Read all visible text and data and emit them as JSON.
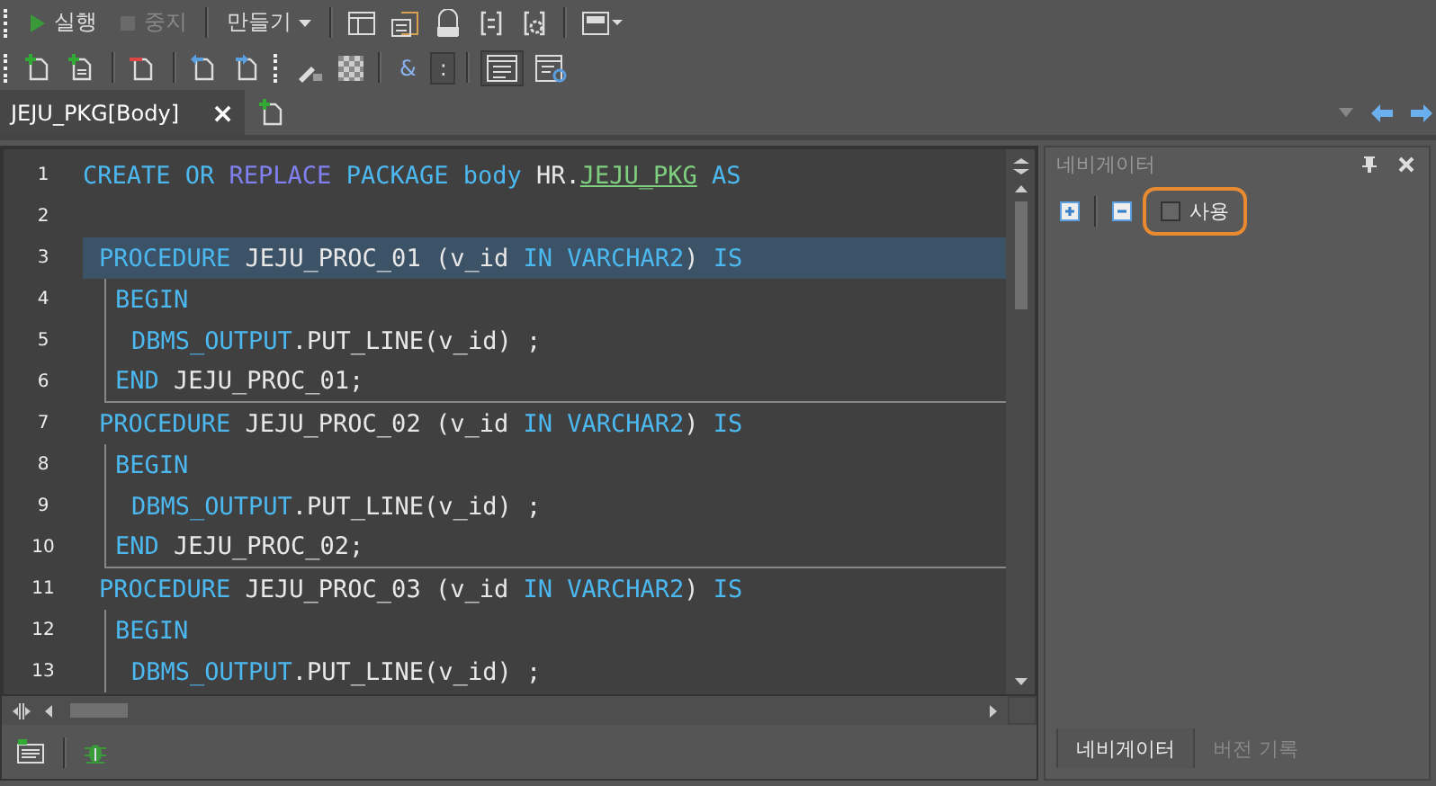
{
  "toolbar": {
    "run_label": "실행",
    "stop_label": "중지",
    "stop_disabled": true,
    "create_label": "만들기"
  },
  "toolbar2": {
    "amp_label": "&",
    "colon_label": ":"
  },
  "tabs": [
    {
      "label": "JEJU_PKG[Body]",
      "selected": true,
      "close": "×"
    }
  ],
  "editor": {
    "lines": [
      {
        "number": "1",
        "kind": "header",
        "selected": false,
        "tokens": [
          {
            "text": "CREATE OR ",
            "kind": "kw"
          },
          {
            "text": "REPLACE",
            "kind": "kw2"
          },
          {
            "text": " PACKAGE body ",
            "kind": "kw"
          },
          {
            "text": "HR.",
            "kind": "plain"
          },
          {
            "text": "JEJU_PKG",
            "kind": "link"
          },
          {
            "text": " AS",
            "kind": "kw"
          }
        ]
      },
      {
        "number": "2",
        "kind": "blank",
        "selected": false
      },
      {
        "number": "3",
        "kind": "proc",
        "selected": true,
        "tokens": [
          {
            "text": "PROCEDURE",
            "kind": "kw"
          },
          {
            "text": " JEJU_PROC_01 (v_id ",
            "kind": "plain"
          },
          {
            "text": "IN VARCHAR2",
            "kind": "kw"
          },
          {
            "text": ") ",
            "kind": "plain"
          },
          {
            "text": "IS",
            "kind": "kw"
          }
        ]
      },
      {
        "number": "4",
        "kind": "begin",
        "selected": false,
        "tokens": [
          {
            "text": "BEGIN",
            "kind": "kw"
          }
        ]
      },
      {
        "number": "5",
        "kind": "body",
        "selected": false,
        "tokens": [
          {
            "text": "DBMS_OUTPUT",
            "kind": "kw"
          },
          {
            "text": ".PUT_LINE(v_id) ;",
            "kind": "plain"
          }
        ]
      },
      {
        "number": "6",
        "kind": "end",
        "selected": false,
        "tokens": [
          {
            "text": "END",
            "kind": "kw"
          },
          {
            "text": " JEJU_PROC_01;",
            "kind": "plain"
          }
        ]
      },
      {
        "number": "7",
        "kind": "proc",
        "selected": false,
        "tokens": [
          {
            "text": "PROCEDURE",
            "kind": "kw"
          },
          {
            "text": " JEJU_PROC_02 (v_id ",
            "kind": "plain"
          },
          {
            "text": "IN VARCHAR2",
            "kind": "kw"
          },
          {
            "text": ") ",
            "kind": "plain"
          },
          {
            "text": "IS",
            "kind": "kw"
          }
        ]
      },
      {
        "number": "8",
        "kind": "begin",
        "selected": false,
        "tokens": [
          {
            "text": "BEGIN",
            "kind": "kw"
          }
        ]
      },
      {
        "number": "9",
        "kind": "body",
        "selected": false,
        "tokens": [
          {
            "text": "DBMS_OUTPUT",
            "kind": "kw"
          },
          {
            "text": ".PUT_LINE(v_id) ;",
            "kind": "plain"
          }
        ]
      },
      {
        "number": "10",
        "kind": "end",
        "selected": false,
        "tokens": [
          {
            "text": "END",
            "kind": "kw"
          },
          {
            "text": " JEJU_PROC_02;",
            "kind": "plain"
          }
        ]
      },
      {
        "number": "11",
        "kind": "proc",
        "selected": false,
        "tokens": [
          {
            "text": "PROCEDURE",
            "kind": "kw"
          },
          {
            "text": " JEJU_PROC_03 (v_id ",
            "kind": "plain"
          },
          {
            "text": "IN VARCHAR2",
            "kind": "kw"
          },
          {
            "text": ") ",
            "kind": "plain"
          },
          {
            "text": "IS",
            "kind": "kw"
          }
        ]
      },
      {
        "number": "12",
        "kind": "begin",
        "selected": false,
        "tokens": [
          {
            "text": "BEGIN",
            "kind": "kw"
          }
        ]
      },
      {
        "number": "13",
        "kind": "body",
        "selected": false,
        "tokens": [
          {
            "text": "DBMS_OUTPUT",
            "kind": "kw"
          },
          {
            "text": ".PUT_LINE(v_id) ;",
            "kind": "plain"
          }
        ]
      }
    ]
  },
  "navigator": {
    "title": "네비게이터",
    "use_label": "사용",
    "use_checked": false,
    "highlighted": true,
    "tabs": [
      {
        "label": "네비게이터",
        "selected": true
      },
      {
        "label": "버전 기록",
        "selected": false
      }
    ]
  }
}
